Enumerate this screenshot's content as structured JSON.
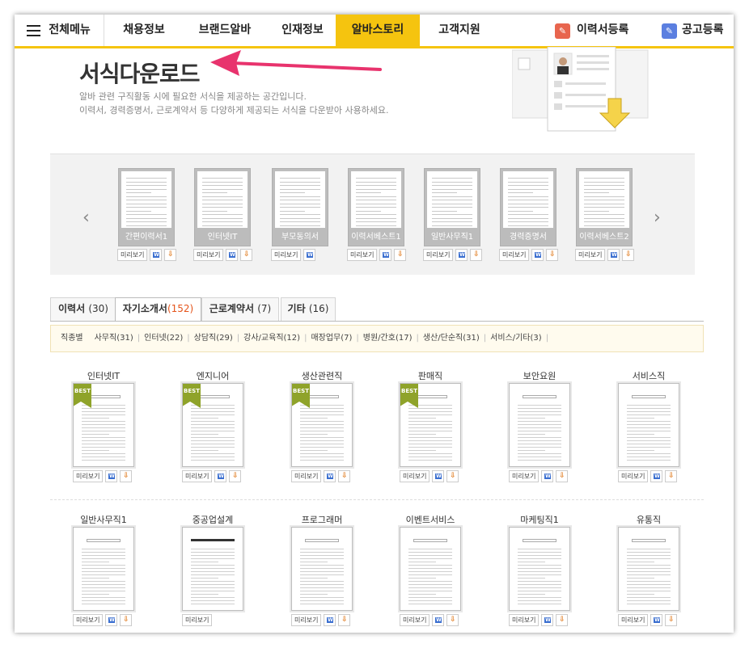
{
  "nav": {
    "menu_label": "전체메뉴",
    "items": [
      {
        "label": "채용정보"
      },
      {
        "label": "브랜드알바"
      },
      {
        "label": "인재정보"
      },
      {
        "label": "알바스토리",
        "active": true
      },
      {
        "label": "고객지원"
      }
    ],
    "resume_register": "이력서등록",
    "job_register": "공고등록"
  },
  "hero": {
    "title": "서식다운로드",
    "desc_line1": "알바 관련 구직활동 시에 필요한 서식을 제공하는 공간입니다.",
    "desc_line2": "이력서, 경력증명서, 근로계약서 등 다양하게 제공되는 서식을 다운받아 사용하세요."
  },
  "buttons": {
    "preview": "미리보기",
    "word": "W",
    "download": "⇩"
  },
  "carousel": [
    {
      "label": "간편이력서1",
      "word": true,
      "download": true
    },
    {
      "label": "인터넷IT",
      "word": true,
      "download": true
    },
    {
      "label": "부모동의서",
      "word": true,
      "download": false
    },
    {
      "label": "이력서베스트1",
      "word": true,
      "download": true
    },
    {
      "label": "일반사무직1",
      "word": true,
      "download": true
    },
    {
      "label": "경력증명서",
      "word": true,
      "download": true
    },
    {
      "label": "이력서베스트2",
      "word": true,
      "download": true
    }
  ],
  "tabs": [
    {
      "label": "이력서",
      "count": "(30)"
    },
    {
      "label": "자기소개서",
      "count": "(152)",
      "active": true
    },
    {
      "label": "근로계약서",
      "count": "(7)"
    },
    {
      "label": "기타",
      "count": "(16)"
    }
  ],
  "filter": {
    "label": "직종별",
    "items": [
      "사무직(31)",
      "인터넷(22)",
      "상담직(29)",
      "강사/교육직(12)",
      "매장업무(7)",
      "병원/간호(17)",
      "생산/단순직(31)",
      "서비스/기타(3)"
    ]
  },
  "best_label": "BEST",
  "grid_row1": [
    {
      "label": "인터넷IT",
      "best": true
    },
    {
      "label": "엔지니어",
      "best": true
    },
    {
      "label": "생산관련직",
      "best": true
    },
    {
      "label": "판매직",
      "best": true
    },
    {
      "label": "보안요원",
      "best": false
    },
    {
      "label": "서비스직",
      "best": false
    }
  ],
  "grid_row2": [
    {
      "label": "일반사무직1",
      "word": true,
      "download": true
    },
    {
      "label": "중공업설계",
      "word": false,
      "download": false
    },
    {
      "label": "프로그래머",
      "word": true,
      "download": true
    },
    {
      "label": "이벤트서비스",
      "word": true,
      "download": true
    },
    {
      "label": "마케팅직1",
      "word": true,
      "download": true
    },
    {
      "label": "유통직",
      "word": true,
      "download": true
    }
  ],
  "colors": {
    "accent": "#f5c40f",
    "arrow": "#e8336d",
    "count_active": "#e5541b",
    "resume_icon": "#e8654e",
    "job_icon": "#5b7fe0"
  }
}
